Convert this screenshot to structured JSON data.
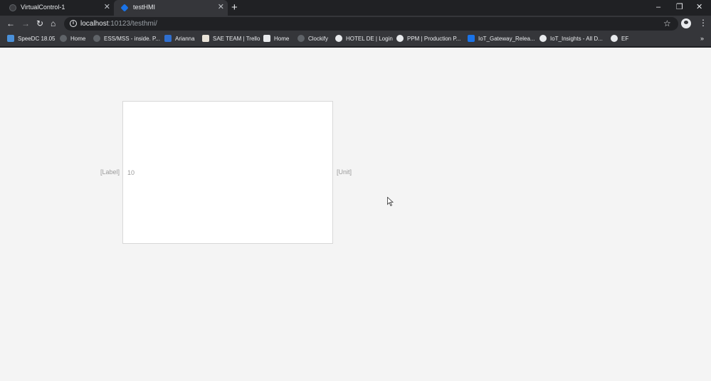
{
  "tabs": [
    {
      "title": "VirtualControl-1",
      "active": false
    },
    {
      "title": "testHMI",
      "active": true
    }
  ],
  "window_controls": {
    "minimize": "–",
    "restore": "❐",
    "close": "✕"
  },
  "address_bar": {
    "host": "localhost",
    "path": ":10123/testhmi/"
  },
  "bookmarks": [
    {
      "label": "SpeeDC 18.05",
      "icon": "speedc-icon",
      "color": "#4a90d9"
    },
    {
      "label": "Home",
      "icon": "globe-icon",
      "color": "#5f6368"
    },
    {
      "label": "ESS/MSS - inside. P...",
      "icon": "globe-icon",
      "color": "#5f6368"
    },
    {
      "label": "Arianna",
      "icon": "arianna-icon",
      "color": "#2f6fd0"
    },
    {
      "label": "SAE TEAM | Trello",
      "icon": "trello-icon",
      "color": "#e9e3d8"
    },
    {
      "label": "Home",
      "icon": "sharepoint-icon",
      "color": "#e8eaed"
    },
    {
      "label": "Clockify",
      "icon": "clockify-icon",
      "color": "#5f6368"
    },
    {
      "label": "HOTEL DE | Login",
      "icon": "globe-icon",
      "color": "#e8eaed"
    },
    {
      "label": "PPM | Production P...",
      "icon": "globe-icon",
      "color": "#e8eaed"
    },
    {
      "label": "IoT_Gateway_Relea...",
      "icon": "azure-devops-icon",
      "color": "#1a73e8"
    },
    {
      "label": "IoT_Insights - All D...",
      "icon": "globe-icon",
      "color": "#e8eaed"
    },
    {
      "label": "EF",
      "icon": "globe-icon",
      "color": "#e8eaed"
    }
  ],
  "bookmarks_overflow": "»",
  "hmi": {
    "label": "[Label]",
    "value": "10",
    "unit": "[Unit]"
  }
}
